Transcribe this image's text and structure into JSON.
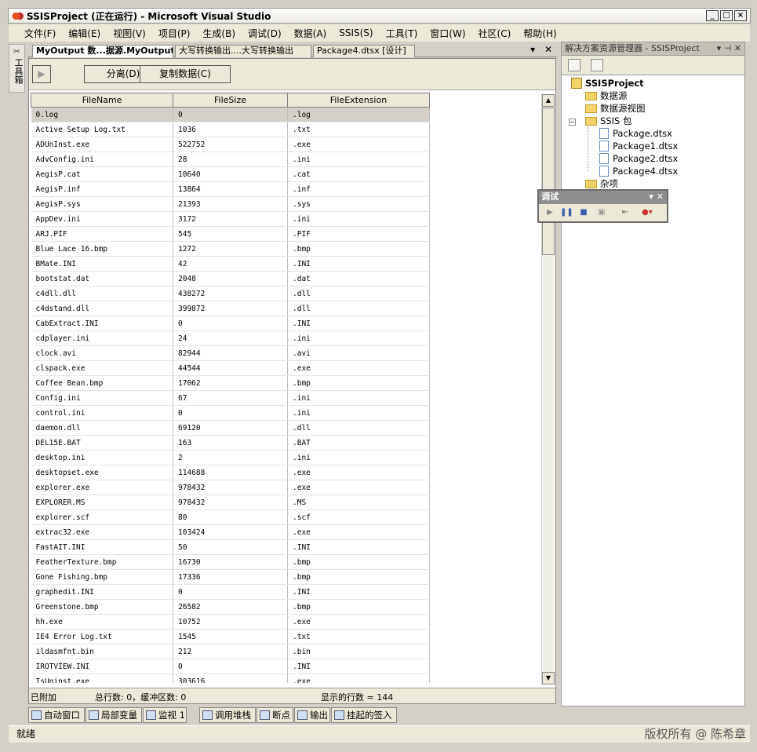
{
  "window": {
    "title": "SSISProject (正在运行) - Microsoft Visual Studio"
  },
  "menu": [
    "文件(F)",
    "编辑(E)",
    "视图(V)",
    "项目(P)",
    "生成(B)",
    "调试(D)",
    "数据(A)",
    "SSIS(S)",
    "工具(T)",
    "窗口(W)",
    "社区(C)",
    "帮助(H)"
  ],
  "toolbox": {
    "label": "工具箱"
  },
  "doc_tabs": [
    "MyOutput 数...据源.MyOutput",
    "大写转换输出....大写转换输出",
    "Package4.dtsx [设计]"
  ],
  "viewer_toolbar": {
    "detach": "分离(D)",
    "copy": "复制数据(C)"
  },
  "grid": {
    "columns": [
      "FileName",
      "FileSize",
      "FileExtension"
    ],
    "rows": [
      [
        "0.log",
        "0",
        ".log"
      ],
      [
        "Active Setup Log.txt",
        "1036",
        ".txt"
      ],
      [
        "ADUnInst.exe",
        "522752",
        ".exe"
      ],
      [
        "AdvConfig.ini",
        "28",
        ".ini"
      ],
      [
        "AegisP.cat",
        "10640",
        ".cat"
      ],
      [
        "AegisP.inf",
        "13864",
        ".inf"
      ],
      [
        "AegisP.sys",
        "21393",
        ".sys"
      ],
      [
        "AppDev.ini",
        "3172",
        ".ini"
      ],
      [
        "ARJ.PIF",
        "545",
        ".PIF"
      ],
      [
        "Blue Lace 16.bmp",
        "1272",
        ".bmp"
      ],
      [
        "BMate.INI",
        "42",
        ".INI"
      ],
      [
        "bootstat.dat",
        "2048",
        ".dat"
      ],
      [
        "c4dll.dll",
        "438272",
        ".dll"
      ],
      [
        "c4dstand.dll",
        "399872",
        ".dll"
      ],
      [
        "CabExtract.INI",
        "0",
        ".INI"
      ],
      [
        "cdplayer.ini",
        "24",
        ".ini"
      ],
      [
        "clock.avi",
        "82944",
        ".avi"
      ],
      [
        "clspack.exe",
        "44544",
        ".exe"
      ],
      [
        "Coffee Bean.bmp",
        "17062",
        ".bmp"
      ],
      [
        "Config.ini",
        "67",
        ".ini"
      ],
      [
        "control.ini",
        "0",
        ".ini"
      ],
      [
        "daemon.dll",
        "69120",
        ".dll"
      ],
      [
        "DEL15E.BAT",
        "163",
        ".BAT"
      ],
      [
        "desktop.ini",
        "2",
        ".ini"
      ],
      [
        "desktopset.exe",
        "114688",
        ".exe"
      ],
      [
        "explorer.exe",
        "978432",
        ".exe"
      ],
      [
        "EXPLORER.MS",
        "978432",
        ".MS"
      ],
      [
        "explorer.scf",
        "80",
        ".scf"
      ],
      [
        "extrac32.exe",
        "103424",
        ".exe"
      ],
      [
        "FastAIT.INI",
        "50",
        ".INI"
      ],
      [
        "FeatherTexture.bmp",
        "16730",
        ".bmp"
      ],
      [
        "Gone Fishing.bmp",
        "17336",
        ".bmp"
      ],
      [
        "graphedit.INI",
        "0",
        ".INI"
      ],
      [
        "Greenstone.bmp",
        "26582",
        ".bmp"
      ],
      [
        "hh.exe",
        "10752",
        ".exe"
      ],
      [
        "IE4 Error Log.txt",
        "1545",
        ".txt"
      ],
      [
        "ildasmfnt.bin",
        "212",
        ".bin"
      ],
      [
        "IROTVIEW.INI",
        "0",
        ".INI"
      ],
      [
        "IsUninst.exe",
        "303616",
        ".exe"
      ]
    ]
  },
  "viewer_status": {
    "state": "已附加",
    "counts": "总行数: 0，缓冲区数: 0",
    "shown": "显示的行数 = 144"
  },
  "solution_explorer": {
    "title": "解决方案资源管理器 - SSISProject",
    "project": "SSISProject",
    "items": [
      "数据源",
      "数据源视图",
      "SSIS 包",
      "Package.dtsx",
      "Package1.dtsx",
      "Package2.dtsx",
      "Package4.dtsx",
      "杂项"
    ]
  },
  "debug_toolbar": {
    "title": "调试"
  },
  "bottom_tabs": [
    "自动窗口",
    "局部变量",
    "监视 1",
    "调用堆栈",
    "断点",
    "输出",
    "挂起的签入"
  ],
  "status": {
    "text": "就绪"
  },
  "watermark": "版权所有 @ 陈希章"
}
